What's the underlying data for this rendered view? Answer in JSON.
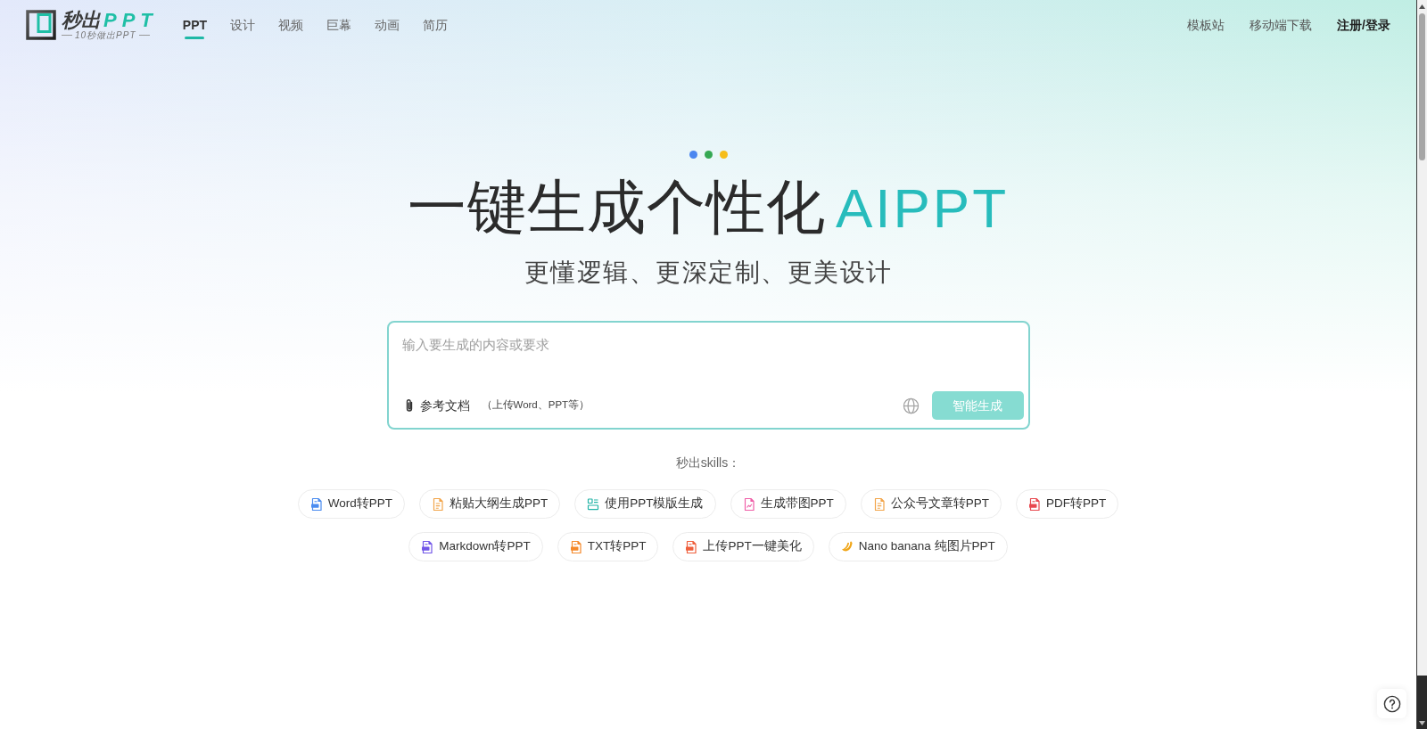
{
  "header": {
    "logo": {
      "text": "秒出",
      "text_highlight": "PPT",
      "tagline": "10秒做出PPT"
    },
    "nav": [
      {
        "label": "PPT",
        "selected": true
      },
      {
        "label": "设计",
        "selected": false
      },
      {
        "label": "视频",
        "selected": false
      },
      {
        "label": "巨幕",
        "selected": false
      },
      {
        "label": "动画",
        "selected": false
      },
      {
        "label": "简历",
        "selected": false
      }
    ],
    "links": [
      "模板站",
      "移动端下载"
    ],
    "login": "注册/登录"
  },
  "hero": {
    "title": "一键生成个性化",
    "title_highlight": "AIPPT",
    "subtitle": "更懂逻辑、更深定制、更美设计"
  },
  "prompt": {
    "placeholder": "输入要生成的内容或要求",
    "attach": "参考文档",
    "attach_hint": "（上传Word、PPT等）",
    "submit": {
      "label": "智能生成",
      "disabled": true
    }
  },
  "skills": {
    "label": "秒出skills：",
    "items": [
      {
        "label": "Word转PPT",
        "color": "#4a8cf0"
      },
      {
        "label": "粘贴大纲生成PPT",
        "color": "#f2a54a"
      },
      {
        "label": "使用PPT模版生成",
        "color": "#22b3a6"
      },
      {
        "label": "生成带图PPT",
        "color": "#ef5fa8"
      },
      {
        "label": "公众号文章转PPT",
        "color": "#f2a54a"
      },
      {
        "label": "PDF转PPT",
        "color": "#e8474e"
      },
      {
        "label": "Markdown转PPT",
        "color": "#7257e8"
      },
      {
        "label": "TXT转PPT",
        "color": "#f5892a"
      },
      {
        "label": "上传PPT一键美化",
        "color": "#ef5f3c"
      },
      {
        "label": "Nano banana 纯图片PPT",
        "color": "#f0a516"
      }
    ]
  }
}
